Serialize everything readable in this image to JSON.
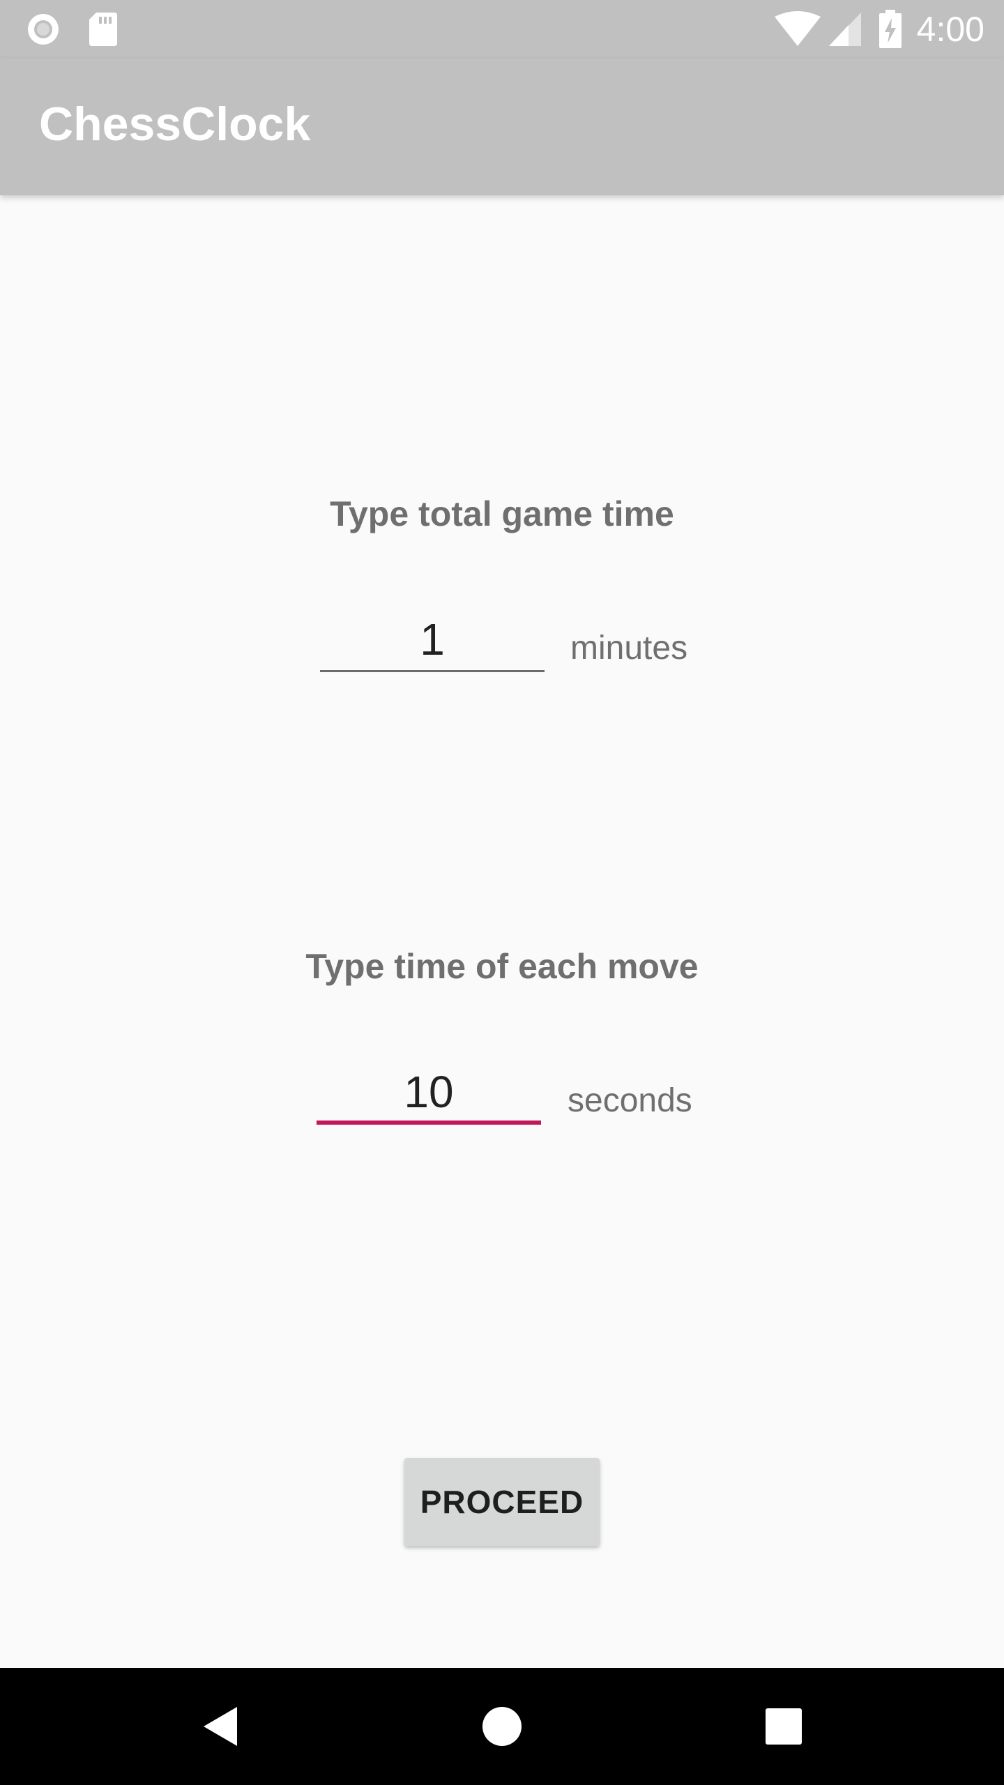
{
  "status_bar": {
    "time": "4:00",
    "left_icons": [
      "record-icon",
      "sd-card-icon"
    ],
    "right_icons": [
      "wifi-icon",
      "cell-signal-icon",
      "battery-charging-icon"
    ]
  },
  "app_bar": {
    "title": "ChessClock",
    "background_color": "#c0c0c0"
  },
  "form": {
    "total_time": {
      "label": "Type total game time",
      "value": "1",
      "unit": "minutes"
    },
    "move_time": {
      "label": "Type time of each move",
      "value": "10",
      "unit": "seconds",
      "focused": true,
      "accent_color": "#c2185b"
    },
    "proceed_label": "PROCEED"
  },
  "nav_bar": {
    "icons": [
      "back-icon",
      "home-icon",
      "recents-icon"
    ]
  }
}
